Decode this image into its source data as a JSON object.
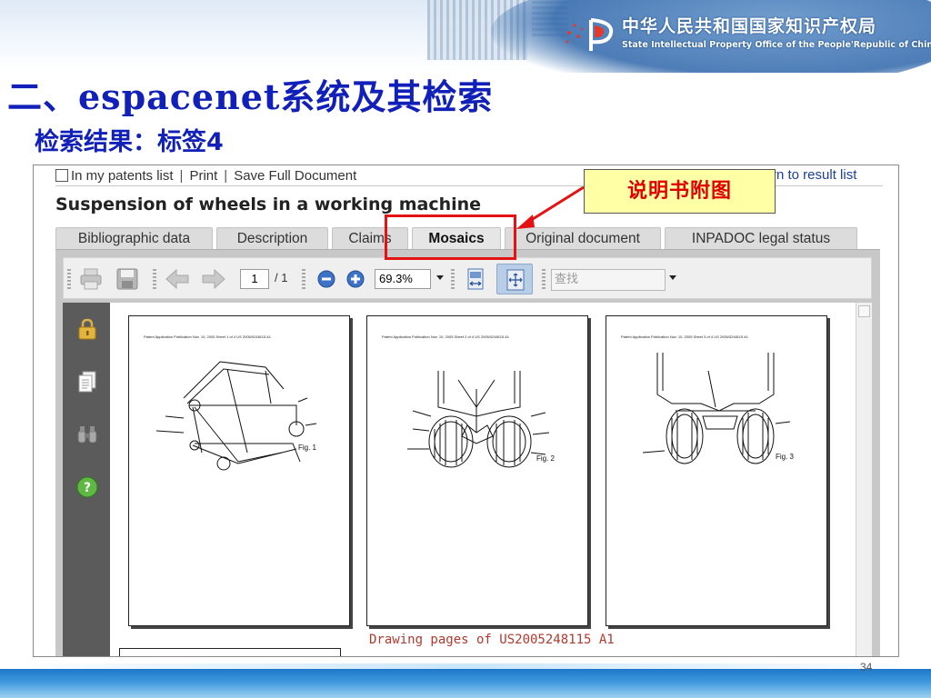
{
  "header": {
    "org_name_cn": "中华人民共和国国家知识产权局",
    "org_name_en": "State Intellectual Property Office of the People'Republic of China"
  },
  "slide": {
    "title": "二、espacenet系统及其检索",
    "subtitle": "检索结果：标签4",
    "annotation": "说明书附图",
    "page_number": "34"
  },
  "screenshot": {
    "links": {
      "my_patents": "In my patents list",
      "print": "Print",
      "save": "Save Full Document",
      "return": "rn to result list"
    },
    "doc_title": "Suspension of wheels in a working machine",
    "tabs": [
      {
        "label": "Bibliographic data"
      },
      {
        "label": "Description"
      },
      {
        "label": "Claims"
      },
      {
        "label": "Mosaics"
      },
      {
        "label": "Original document"
      },
      {
        "label": "INPADOC legal status"
      }
    ],
    "active_tab": "Mosaics",
    "toolbar": {
      "page_current": "1",
      "page_total": "/ 1",
      "zoom": "69.3%",
      "find_placeholder": "查找"
    },
    "pages": [
      {
        "header": "Patent Application Publication   Nov. 10, 2005  Sheet 1 of 4        US 2005/0248115 A1",
        "fig": "Fig. 1"
      },
      {
        "header": "Patent Application Publication   Nov. 10, 2005  Sheet 2 of 4        US 2005/0248115 A1",
        "fig": "Fig. 2"
      },
      {
        "header": "Patent Application Publication   Nov. 10, 2005  Sheet 3 of 4        US 2005/0248115 A1",
        "fig": "Fig. 3"
      }
    ],
    "caption": "Drawing pages of US2005248115 A1"
  },
  "colors": {
    "title": "#1020b8",
    "annotation_text": "#e00000",
    "annotation_bg": "#ffffa6",
    "highlight_box": "#e41212",
    "caption": "#b03a2e"
  }
}
